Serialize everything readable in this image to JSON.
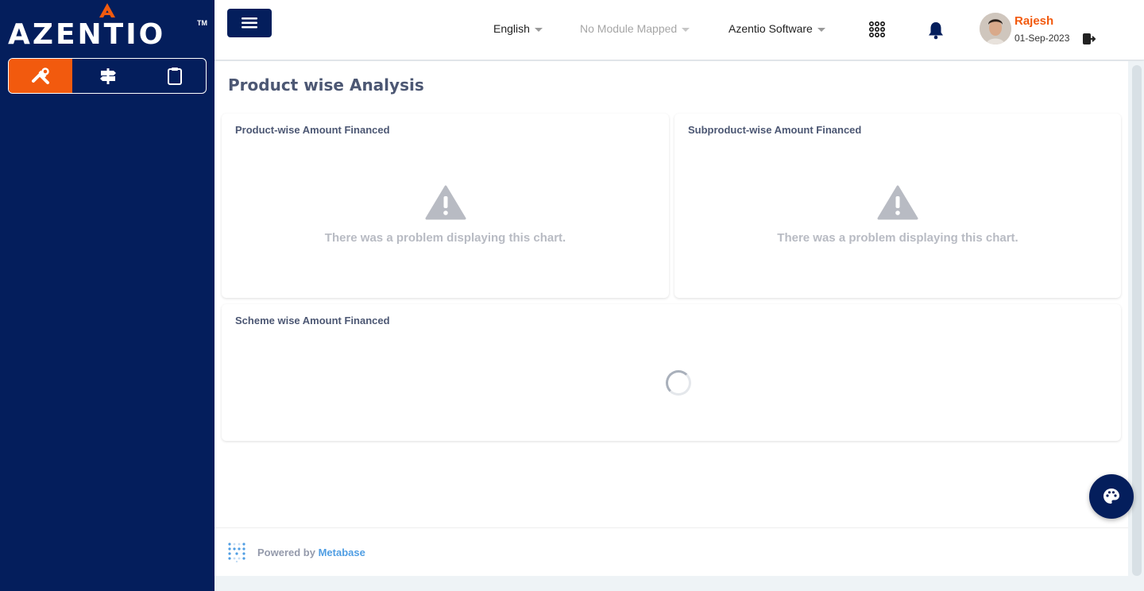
{
  "brand": {
    "name": "AZENTIO",
    "trademark": "TM",
    "accent": "#f25a0e",
    "navy": "#041e5c"
  },
  "sidebar": {
    "tabs": [
      {
        "icon": "tools-icon",
        "active": true
      },
      {
        "icon": "signpost-icon",
        "active": false
      },
      {
        "icon": "clipboard-icon",
        "active": false
      }
    ]
  },
  "header": {
    "language": "English",
    "module": "No Module Mapped",
    "company": "Azentio Software",
    "user": {
      "name": "Rajesh",
      "date": "01-Sep-2023"
    }
  },
  "page": {
    "title": "Product wise Analysis"
  },
  "cards": [
    {
      "title": "Product-wise Amount Financed",
      "status": "There was a problem displaying this chart."
    },
    {
      "title": "Subproduct-wise Amount Financed",
      "status": "There was a problem displaying this chart."
    },
    {
      "title": "Scheme wise Amount Financed",
      "status": "loading"
    }
  ],
  "footer": {
    "prefix": "Powered by",
    "link": "Metabase"
  }
}
